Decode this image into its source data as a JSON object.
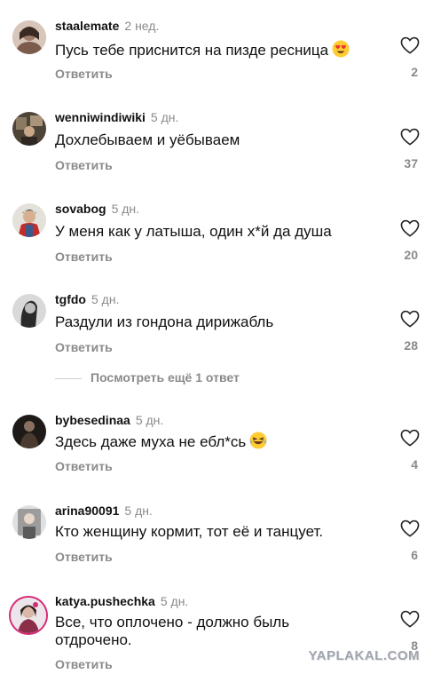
{
  "comments": [
    {
      "username": "staalemate",
      "time": "2 нед.",
      "text": "Пусь тебе приснится на пизде ресница",
      "emoji": "heart-eyes",
      "reply": "Ответить",
      "likes": "2",
      "avatar_color": "#c9b4a8"
    },
    {
      "username": "wenniwindiwiki",
      "time": "5 дн.",
      "text": "Дохлебываем и уёбываем",
      "reply": "Ответить",
      "likes": "37",
      "avatar_color": "#6b5a4a"
    },
    {
      "username": "sovabog",
      "time": "5 дн.",
      "text": "У меня как у латыша, один х*й да душа",
      "reply": "Ответить",
      "likes": "20",
      "avatar_color": "#d8d2c8"
    },
    {
      "username": "tgfdo",
      "time": "5 дн.",
      "text": "Раздули из гондона дирижабль",
      "reply": "Ответить",
      "likes": "28",
      "avatar_color": "#3a3a3a"
    },
    {
      "username": "bybesedinaa",
      "time": "5 дн.",
      "text": "Здесь даже муха не ебл*сь",
      "emoji": "laugh",
      "reply": "Ответить",
      "likes": "4",
      "avatar_color": "#2c2624"
    },
    {
      "username": "arina90091",
      "time": "5 дн.",
      "text": "Кто женщину кормит, тот её и танцует.",
      "reply": "Ответить",
      "likes": "6",
      "avatar_color": "#b8b8b8"
    },
    {
      "username": "katya.pushechka",
      "time": "5 дн.",
      "text": "Все, что оплочено - должно быль отдрочено.",
      "reply": "Ответить",
      "likes": "8",
      "avatar_color": "#c4b9c0"
    }
  ],
  "more_replies": "Посмотреть ещё 1 ответ",
  "watermark": "YAPLAKAL.COM",
  "colors": {
    "secondary_text": "#8a8a8a",
    "heart_outline": "#262626"
  }
}
